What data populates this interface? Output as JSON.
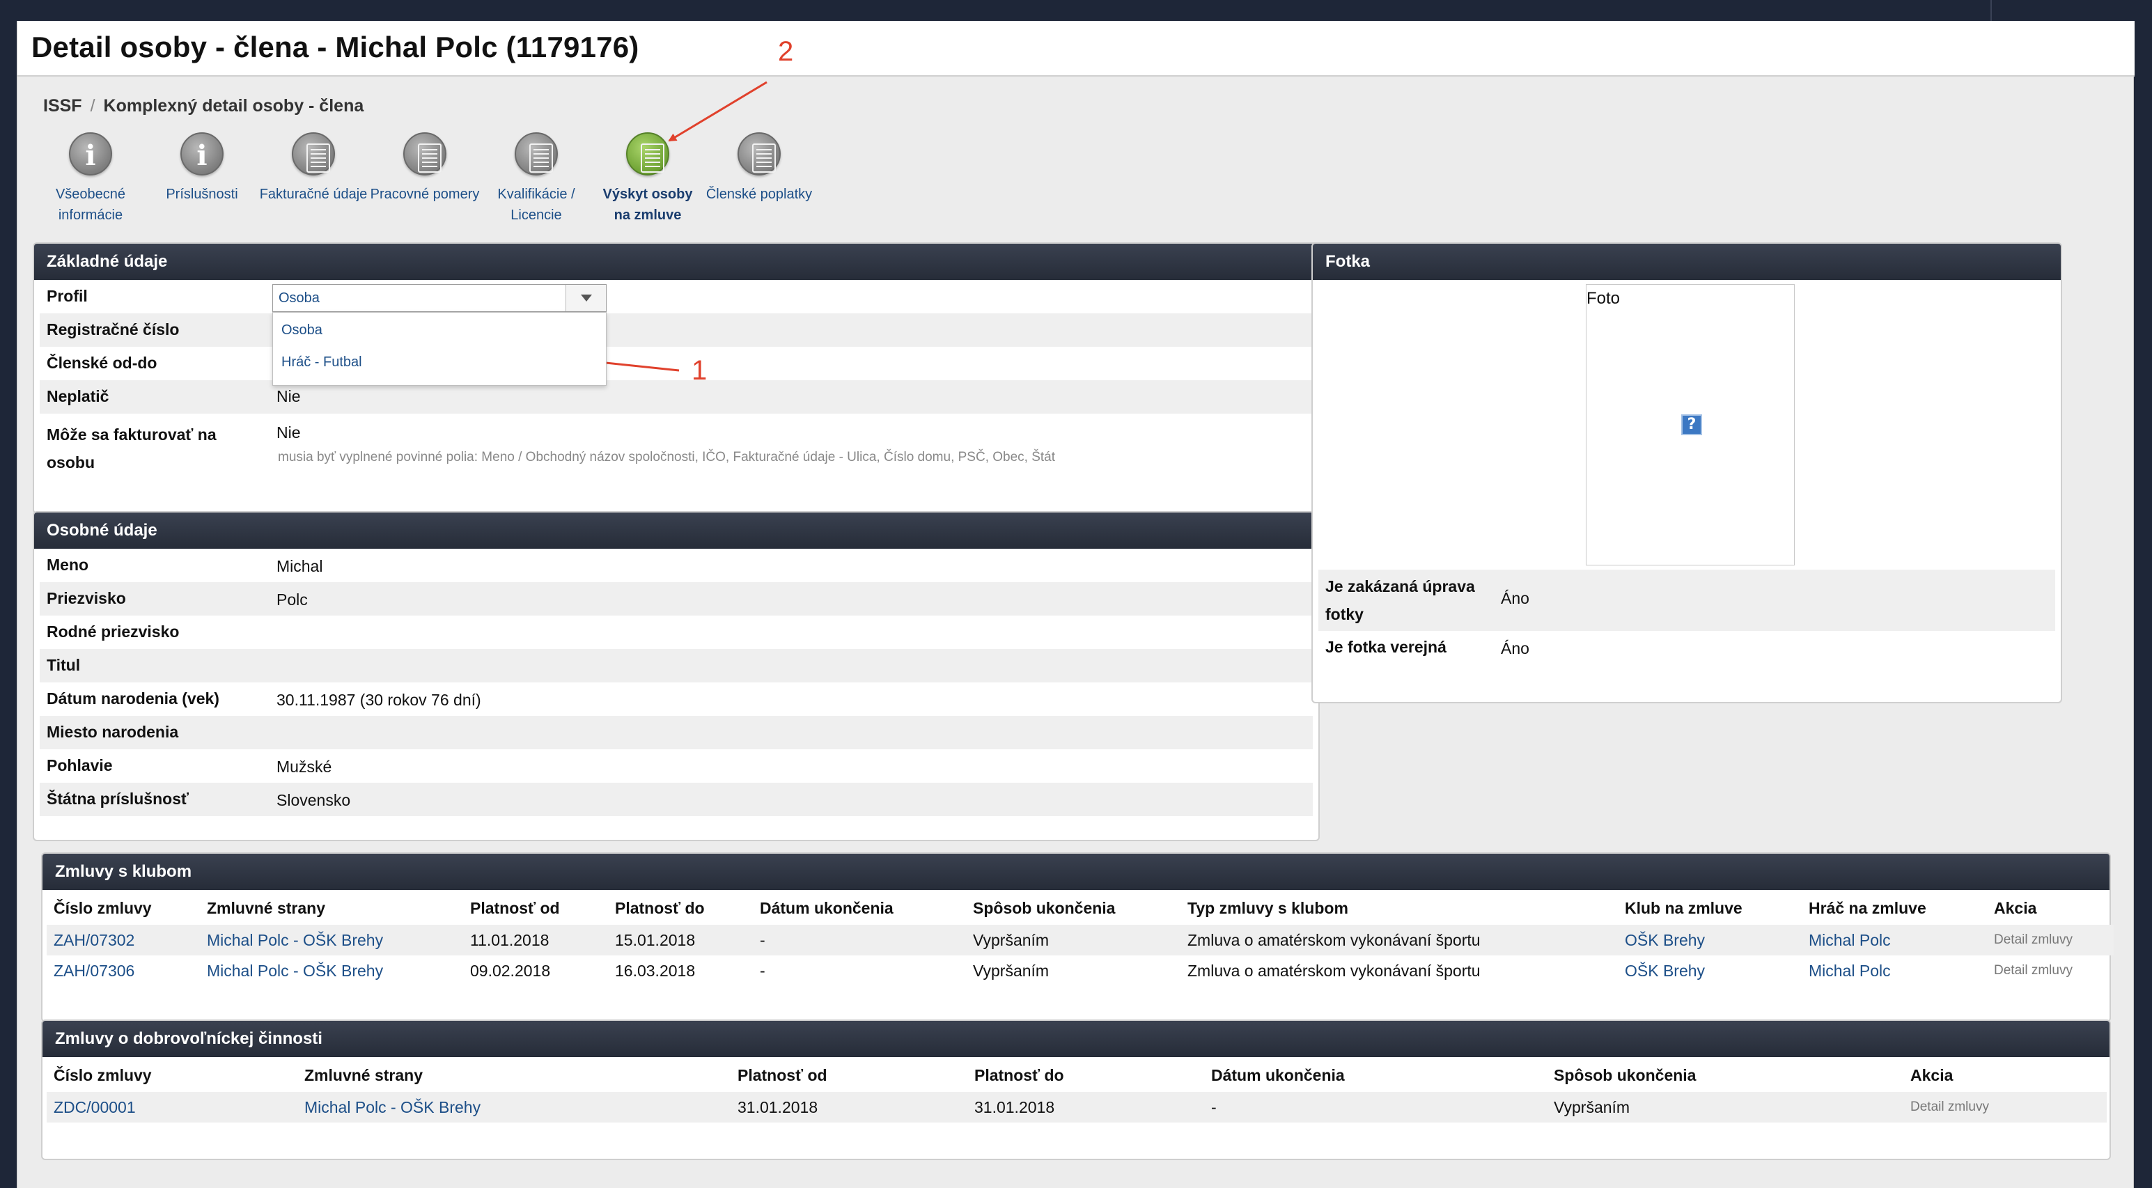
{
  "page": {
    "title": "Detail osoby - člena - Michal Polc (1179176)",
    "breadcrumb": [
      "ISSF",
      "Komplexný detail osoby - člena"
    ]
  },
  "nav_icons": [
    {
      "label_line1": "Všeobecné",
      "label_line2": "informácie",
      "icon": "info-icon"
    },
    {
      "label_line1": "Príslušnosti",
      "label_line2": "",
      "icon": "info-icon"
    },
    {
      "label_line1": "Fakturačné údaje",
      "label_line2": "",
      "icon": "document-icon"
    },
    {
      "label_line1": "Pracovné pomery",
      "label_line2": "",
      "icon": "document-icon"
    },
    {
      "label_line1": "Kvalifikácie /",
      "label_line2": "Licencie",
      "icon": "document-icon"
    },
    {
      "label_line1": "Výskyt osoby",
      "label_line2": "na zmluve",
      "icon": "document-icon",
      "active": true
    },
    {
      "label_line1": "Členské poplatky",
      "label_line2": "",
      "icon": "document-icon"
    }
  ],
  "annotations": {
    "one": "1",
    "two": "2"
  },
  "zakladne": {
    "header": "Základné údaje",
    "profil_label": "Profil",
    "profil_value": "Osoba",
    "profil_options": [
      "Osoba",
      "Hráč - Futbal"
    ],
    "reg_label": "Registračné číslo",
    "clenske_label": "Členské od-do",
    "neplatic_label": "Neplatič",
    "neplatic_value": "Nie",
    "fakt_label_1": "Môže sa fakturovať na",
    "fakt_label_2": "osobu",
    "fakt_value": "Nie",
    "fakt_note": "musia byť vyplnené povinné polia: Meno / Obchodný názov spoločnosti, IČO, Fakturačné údaje - Ulica, Číslo domu, PSČ, Obec, Štát"
  },
  "osobne": {
    "header": "Osobné údaje",
    "rows": [
      {
        "label": "Meno",
        "value": "Michal"
      },
      {
        "label": "Priezvisko",
        "value": "Polc"
      },
      {
        "label": "Rodné priezvisko",
        "value": ""
      },
      {
        "label": "Titul",
        "value": ""
      },
      {
        "label": "Dátum narodenia (vek)",
        "value": "30.11.1987 (30 rokov 76 dní)"
      },
      {
        "label": "Miesto narodenia",
        "value": ""
      },
      {
        "label": "Pohlavie",
        "value": "Mužské"
      },
      {
        "label": "Štátna príslušnosť",
        "value": "Slovensko"
      }
    ]
  },
  "fotka": {
    "header": "Fotka",
    "caption": "Foto",
    "placeholder_icon": "?",
    "zakazana_label_1": "Je zakázaná úprava",
    "zakazana_label_2": "fotky",
    "zakazana_value": "Áno",
    "verejna_label": "Je fotka verejná",
    "verejna_value": "Áno"
  },
  "zmluvy_klub": {
    "header": "Zmluvy s klubom",
    "columns": [
      "Číslo zmluvy",
      "Zmluvné strany",
      "Platnosť od",
      "Platnosť do",
      "Dátum ukončenia",
      "Spôsob ukončenia",
      "Typ zmluvy s klubom",
      "Klub na zmluve",
      "Hráč na zmluve",
      "Akcia"
    ],
    "rows": [
      [
        "ZAH/07302",
        "Michal Polc - OŠK Brehy",
        "11.01.2018",
        "15.01.2018",
        "-",
        "Vypršaním",
        "Zmluva o amatérskom vykonávaní športu",
        "OŠK Brehy",
        "Michal Polc",
        "Detail zmluvy"
      ],
      [
        "ZAH/07306",
        "Michal Polc - OŠK Brehy",
        "09.02.2018",
        "16.03.2018",
        "-",
        "Vypršaním",
        "Zmluva o amatérskom vykonávaní športu",
        "OŠK Brehy",
        "Michal Polc",
        "Detail zmluvy"
      ]
    ]
  },
  "zmluvy_dobro": {
    "header": "Zmluvy o dobrovoľníckej činnosti",
    "columns": [
      "Číslo zmluvy",
      "Zmluvné strany",
      "Platnosť od",
      "Platnosť do",
      "Dátum ukončenia",
      "Spôsob ukončenia",
      "Akcia"
    ],
    "rows": [
      [
        "ZDC/00001",
        "Michal Polc - OŠK Brehy",
        "31.01.2018",
        "31.01.2018",
        "-",
        "Vypršaním",
        "Detail zmluvy"
      ]
    ]
  }
}
